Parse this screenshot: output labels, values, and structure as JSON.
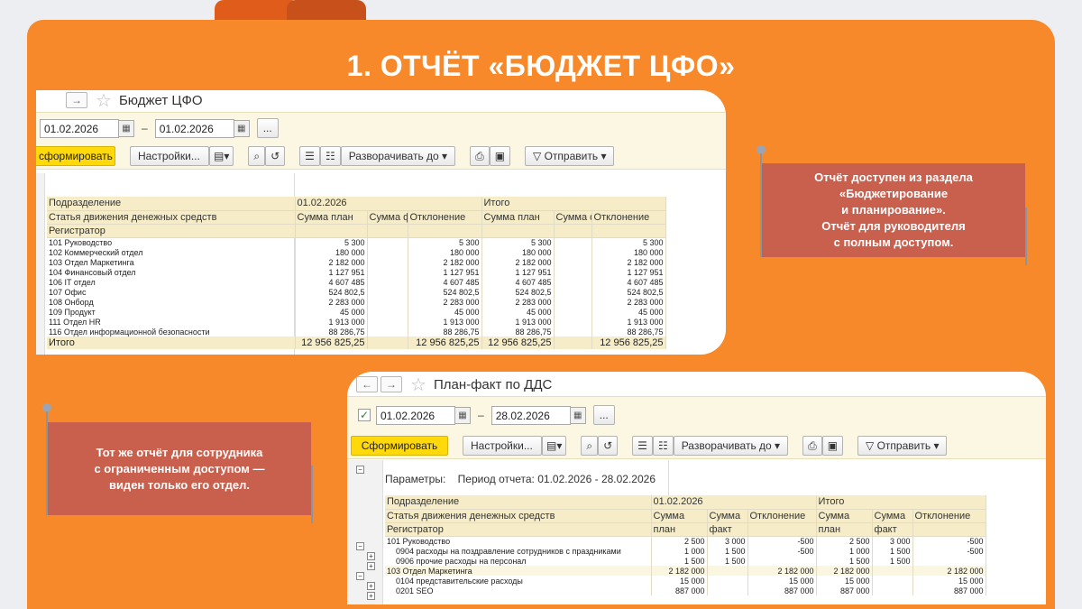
{
  "slide": {
    "title": "1. ОТЧЁТ «БЮДЖЕТ ЦФО»"
  },
  "callout_top": {
    "lines": [
      "Отчёт доступен из раздела",
      "«Бюджетирование",
      "и планирование».",
      "Отчёт для руководителя",
      "с полным доступом."
    ]
  },
  "callout_bottom": {
    "lines": [
      "Тот же отчёт для сотрудника",
      "с ограниченным доступом —",
      "виден только его отдел."
    ]
  },
  "report1": {
    "window_title": "Бюджет ЦФО",
    "date_from": "01.02.2026",
    "date_to": "01.02.2026",
    "more": "...",
    "toolbar": {
      "generate": "сформировать",
      "settings": "Настройки...",
      "expand": "Разворачивать до",
      "send": "Отправить"
    },
    "header_rows": [
      [
        "Подразделение",
        "01.02.2026",
        "Итого"
      ],
      [
        "Статья движения денежных средств",
        "Сумма план",
        "Сумма факт",
        "Отклонение",
        "Сумма план",
        "Сумма факт",
        "Отклонение"
      ],
      [
        "Регистратор"
      ]
    ],
    "rows": [
      [
        "101 Руководство",
        "5 300",
        "",
        "5 300",
        "5 300",
        "",
        "5 300"
      ],
      [
        "102 Коммерческий отдел",
        "180 000",
        "",
        "180 000",
        "180 000",
        "",
        "180 000"
      ],
      [
        "103 Отдел Маркетинга",
        "2 182 000",
        "",
        "2 182 000",
        "2 182 000",
        "",
        "2 182 000"
      ],
      [
        "104 Финансовый отдел",
        "1 127 951",
        "",
        "1 127 951",
        "1 127 951",
        "",
        "1 127 951"
      ],
      [
        "106 IT отдел",
        "4 607 485",
        "",
        "4 607 485",
        "4 607 485",
        "",
        "4 607 485"
      ],
      [
        "107 Офис",
        "524 802,5",
        "",
        "524 802,5",
        "524 802,5",
        "",
        "524 802,5"
      ],
      [
        "108 Онборд",
        "2 283 000",
        "",
        "2 283 000",
        "2 283 000",
        "",
        "2 283 000"
      ],
      [
        "109 Продукт",
        "45 000",
        "",
        "45 000",
        "45 000",
        "",
        "45 000"
      ],
      [
        "111 Отдел HR",
        "1 913 000",
        "",
        "1 913 000",
        "1 913 000",
        "",
        "1 913 000"
      ],
      [
        "116 Отдел информационной безопасности",
        "88 286,75",
        "",
        "88 286,75",
        "88 286,75",
        "",
        "88 286,75"
      ]
    ],
    "total": [
      "Итого",
      "12 956 825,25",
      "",
      "12 956 825,25",
      "12 956 825,25",
      "",
      "12 956 825,25"
    ]
  },
  "report2": {
    "window_title": "План-факт по ДДС",
    "date_from": "01.02.2026",
    "date_to": "28.02.2026",
    "more": "...",
    "toolbar": {
      "generate": "Сформировать",
      "settings": "Настройки...",
      "expand": "Разворачивать до",
      "send": "Отправить"
    },
    "params_label": "Параметры:",
    "params_value": "Период отчета: 01.02.2026 - 28.02.2026",
    "header_rows": [
      [
        "Подразделение",
        "01.02.2026",
        "Итого"
      ],
      [
        "Статья движения денежных средств",
        "Сумма",
        "Сумма",
        "Отклонение",
        "Сумма",
        "Сумма",
        "Отклонение"
      ],
      [
        "Регистратор",
        "план",
        "факт",
        "",
        "план",
        "факт",
        ""
      ]
    ],
    "rows": [
      [
        "101 Руководство",
        "2 500",
        "3 000",
        "-500",
        "2 500",
        "3 000",
        "-500"
      ],
      [
        "0904 расходы на поздравление сотрудников с праздниками",
        "1 000",
        "1 500",
        "-500",
        "1 000",
        "1 500",
        "-500"
      ],
      [
        "0906 прочие расходы на персонал",
        "1 500",
        "1 500",
        "",
        "1 500",
        "1 500",
        ""
      ],
      [
        "103 Отдел Маркетинга",
        "2 182 000",
        "",
        "2 182 000",
        "2 182 000",
        "",
        "2 182 000"
      ],
      [
        "0104 представительские расходы",
        "15 000",
        "",
        "15 000",
        "15 000",
        "",
        "15 000"
      ],
      [
        "0201 SEO",
        "887 000",
        "",
        "887 000",
        "887 000",
        "",
        "887 000"
      ]
    ]
  }
}
